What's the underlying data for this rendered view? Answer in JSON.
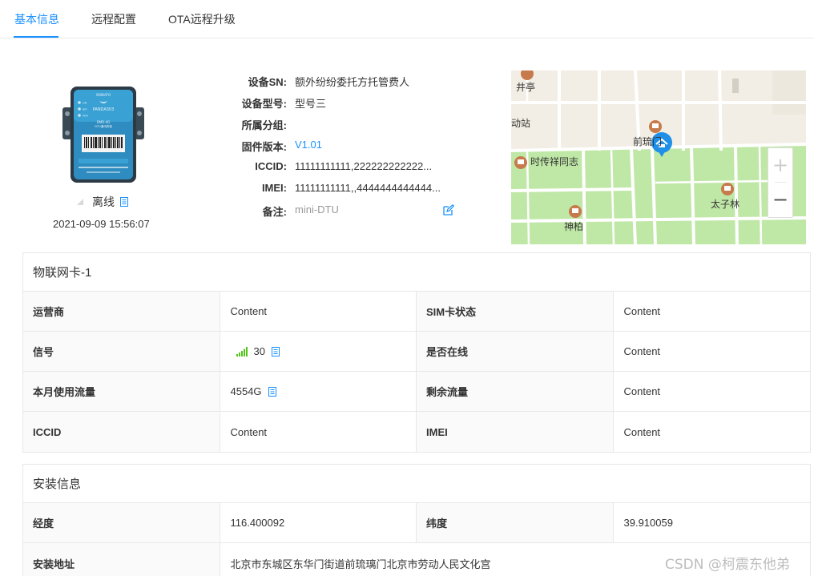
{
  "tabs": [
    {
      "label": "基本信息",
      "active": true
    },
    {
      "label": "远程配置",
      "active": false
    },
    {
      "label": "OTA远程升级",
      "active": false
    }
  ],
  "device": {
    "status": "离线",
    "time": "2021-09-09 15:56:07",
    "image_text": {
      "brand": "SMIDATO",
      "name": "PANDA303",
      "model": "DMD-4G",
      "desc": "DTU通讯终端",
      "indicators": [
        "SIM",
        "NET",
        "PWR"
      ]
    }
  },
  "info": {
    "rows": [
      {
        "label": "设备SN:",
        "value": "额外纷纷委托方托管费人",
        "style": "normal"
      },
      {
        "label": "设备型号:",
        "value": "型号三",
        "style": "normal"
      },
      {
        "label": "所属分组:",
        "value": "",
        "style": "normal"
      },
      {
        "label": "固件版本:",
        "value": "V1.01",
        "style": "link"
      },
      {
        "label": "ICCID:",
        "value": "11111111111,222222222222...",
        "style": "normal"
      },
      {
        "label": "IMEI:",
        "value": "11111111111,,4444444444444...",
        "style": "normal"
      },
      {
        "label": "备注:",
        "value": "mini-DTU",
        "style": "muted"
      }
    ]
  },
  "map": {
    "labels": {
      "jingting": "井亭",
      "dongzhan": "动站",
      "qianliumen": "前琉门",
      "shichuan": "时传祥同志",
      "taizilin": "太子林",
      "shenbai": "神柏"
    },
    "zoom_in": "+",
    "zoom_out": "−",
    "colors": {
      "land": "#f3eee5",
      "park": "#bfe7a6",
      "road": "#ffffff",
      "pin": "#1f8fe8",
      "poi": "#c77a4b"
    }
  },
  "sim_card": {
    "title": "物联网卡-1",
    "rows": [
      [
        {
          "label": "运营商",
          "value": "Content"
        },
        {
          "label": "SIM卡状态",
          "value": "Content"
        }
      ],
      [
        {
          "label": "信号",
          "value": "30",
          "signal": true,
          "note": true
        },
        {
          "label": "是否在线",
          "value": "Content"
        }
      ],
      [
        {
          "label": "本月使用流量",
          "value": "4554G",
          "note": true
        },
        {
          "label": "剩余流量",
          "value": "Content"
        }
      ],
      [
        {
          "label": "ICCID",
          "value": "Content"
        },
        {
          "label": "IMEI",
          "value": "Content"
        }
      ]
    ]
  },
  "install": {
    "title": "安装信息",
    "longitude_label": "经度",
    "longitude": "116.400092",
    "latitude_label": "纬度",
    "latitude": "39.910059",
    "address_label": "安装地址",
    "address": "北京市东城区东华门街道前琉璃门北京市劳动人民文化宫"
  },
  "watermark": "CSDN @柯震东他弟"
}
